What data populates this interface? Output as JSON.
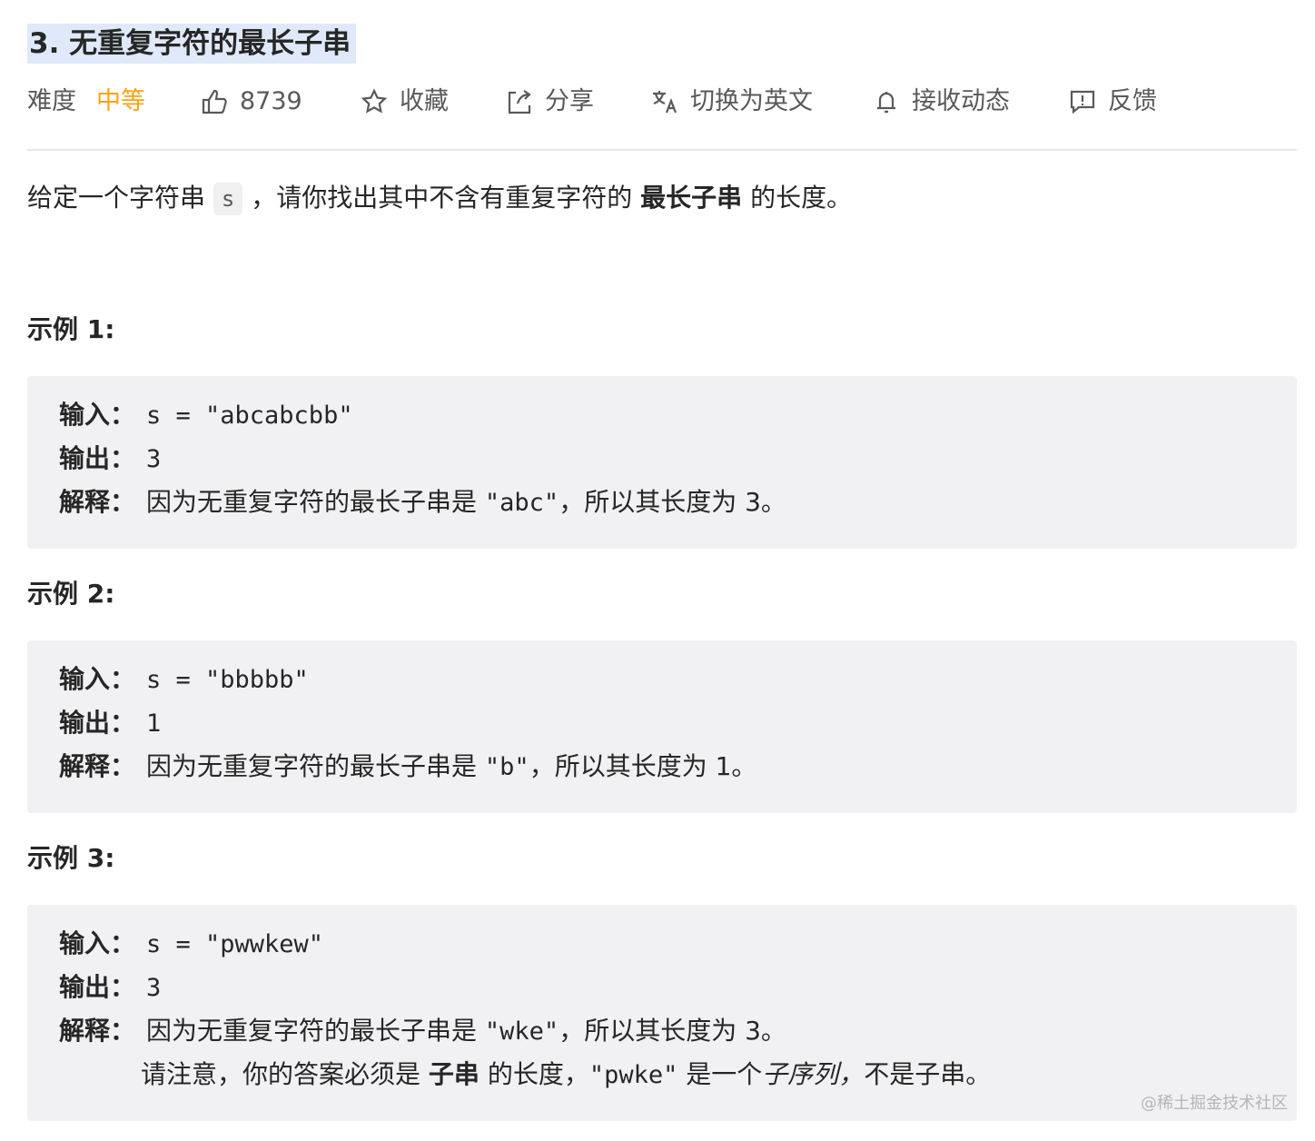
{
  "problem": {
    "title": "3. 无重复字符的最长子串"
  },
  "meta": {
    "difficulty_label": "难度",
    "difficulty_value": "中等",
    "likes": "8739",
    "favorite": "收藏",
    "share": "分享",
    "translate": "切换为英文",
    "subscribe": "接收动态",
    "feedback": "反馈"
  },
  "description": {
    "part1": "给定一个字符串 ",
    "code": "s",
    "part2": " ，请你找出其中不含有重复字符的 ",
    "bold": "最长子串",
    "part3": " 的长度。"
  },
  "examples": [
    {
      "title": "示例 1:",
      "input_label": "输入：",
      "input": "s = \"abcabcbb\"",
      "output_label": "输出：",
      "output": "3",
      "explain_label": "解释：",
      "explain_prefix": "因为无重复字符的最长子串是 ",
      "explain_code": "\"abc\"",
      "explain_suffix": "，所以其长度为 3。"
    },
    {
      "title": "示例 2:",
      "input_label": "输入：",
      "input": "s = \"bbbbb\"",
      "output_label": "输出：",
      "output": "1",
      "explain_label": "解释：",
      "explain_prefix": "因为无重复字符的最长子串是 ",
      "explain_code": "\"b\"",
      "explain_suffix": "，所以其长度为 1。"
    },
    {
      "title": "示例 3:",
      "input_label": "输入：",
      "input": "s = \"pwwkew\"",
      "output_label": "输出：",
      "output": "3",
      "explain_label": "解释：",
      "explain_prefix": "因为无重复字符的最长子串是 ",
      "explain_code": "\"wke\"",
      "explain_suffix": "，所以其长度为 3。",
      "note_part1": "请注意，你的答案必须是 ",
      "note_bold": "子串",
      "note_part2": " 的长度，",
      "note_code": "\"pwke\"",
      "note_part3": " 是一个",
      "note_italic": "子序列，",
      "note_part4": "不是子串。"
    }
  ],
  "watermark": "@稀土掘金技术社区"
}
